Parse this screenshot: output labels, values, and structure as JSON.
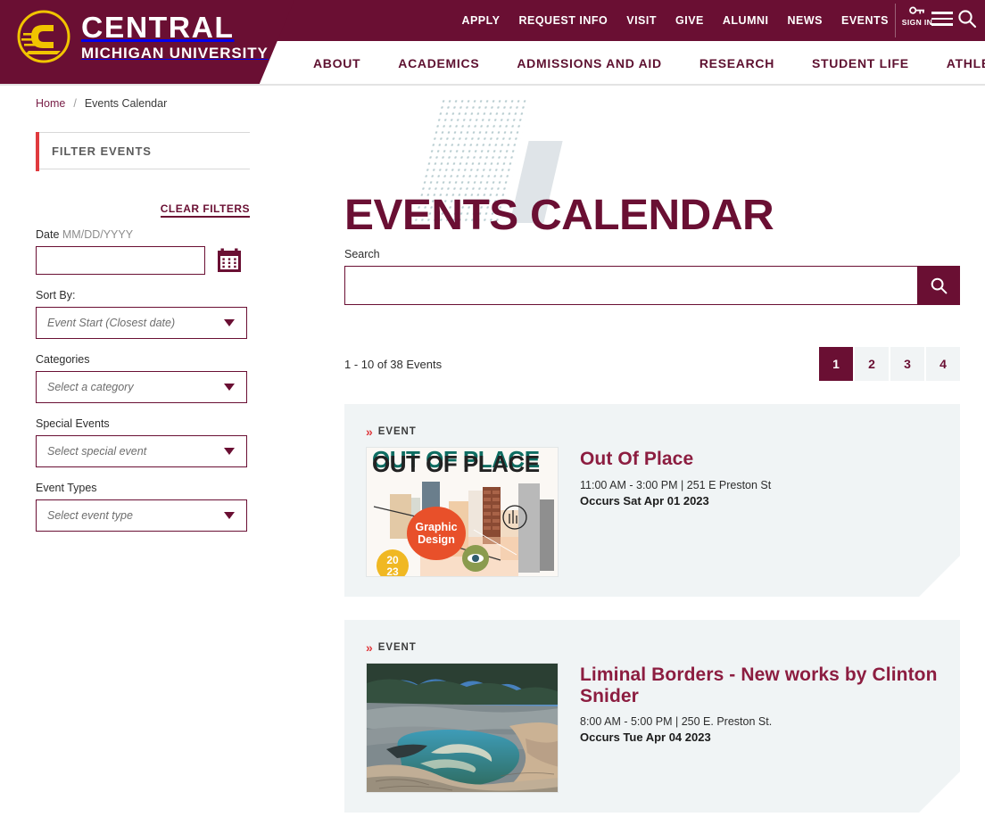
{
  "brand": {
    "name_line1": "CENTRAL",
    "name_line2": "MICHIGAN UNIVERSITY",
    "maroon": "#6a0f33",
    "gold": "#f1c400",
    "red_accent": "#e03a3e"
  },
  "utility_nav": {
    "items": [
      {
        "label": "APPLY"
      },
      {
        "label": "REQUEST INFO"
      },
      {
        "label": "VISIT"
      },
      {
        "label": "GIVE"
      },
      {
        "label": "ALUMNI"
      },
      {
        "label": "NEWS"
      },
      {
        "label": "EVENTS"
      }
    ],
    "sign_in_label": "SIGN IN"
  },
  "main_nav": {
    "items": [
      {
        "label": "ABOUT"
      },
      {
        "label": "ACADEMICS"
      },
      {
        "label": "ADMISSIONS AND AID"
      },
      {
        "label": "RESEARCH"
      },
      {
        "label": "STUDENT LIFE"
      },
      {
        "label": "ATHLETICS"
      }
    ]
  },
  "breadcrumb": {
    "home": "Home",
    "separator": "/",
    "current": "Events Calendar"
  },
  "sidebar": {
    "heading": "FILTER EVENTS",
    "clear_filters": "CLEAR FILTERS",
    "date": {
      "label": "Date",
      "hint": "MM/DD/YYYY",
      "value": "",
      "placeholder": ""
    },
    "sort_by": {
      "label": "Sort By:",
      "selected": "Event Start (Closest date)"
    },
    "categories": {
      "label": "Categories",
      "selected": "Select a category"
    },
    "special_events": {
      "label": "Special Events",
      "selected": "Select special event"
    },
    "event_types": {
      "label": "Event Types",
      "selected": "Select event type"
    }
  },
  "hero": {
    "title": "EVENTS CALENDAR"
  },
  "search": {
    "label": "Search",
    "value": "",
    "placeholder": ""
  },
  "results": {
    "count_text": "1 - 10 of 38 Events",
    "pages": [
      {
        "label": "1",
        "active": true
      },
      {
        "label": "2",
        "active": false
      },
      {
        "label": "3",
        "active": false
      },
      {
        "label": "4",
        "active": false
      }
    ]
  },
  "events": [
    {
      "kicker": "EVENT",
      "title": "Out Of Place",
      "meta": "11:00 AM - 3:00 PM | 251 E Preston St",
      "occurs": "Occurs Sat Apr 01 2023",
      "image_alt": "out-of-place-graphic-design-poster",
      "image_text_top": "OUT OF PLACE",
      "image_badge": "Graphic Design",
      "image_year_top": "20",
      "image_year_bottom": "23"
    },
    {
      "kicker": "EVENT",
      "title": "Liminal Borders - New works by Clinton Snider",
      "meta": "8:00 AM - 5:00 PM | 250 E. Preston St.",
      "occurs": "Occurs Tue Apr 04 2023",
      "image_alt": "liminal-borders-landscape-painting"
    }
  ]
}
